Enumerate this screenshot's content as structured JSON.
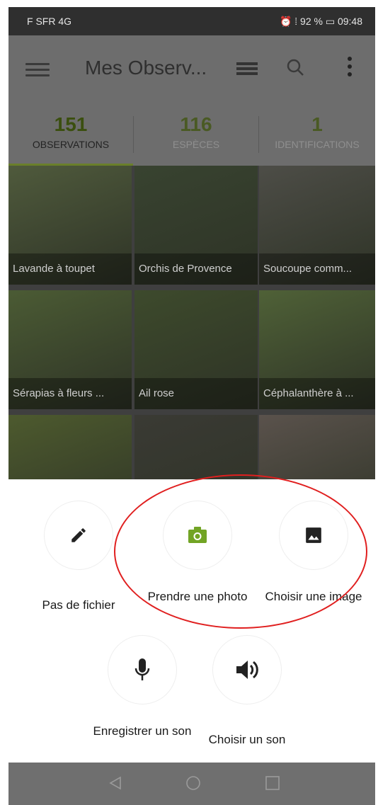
{
  "status": {
    "carrier": "F SFR 4G",
    "right": "⏰ ⁞ 92 % ▭ 09:48"
  },
  "appbar": {
    "title": "Mes Observ..."
  },
  "tabs": [
    {
      "count": "151",
      "label": "OBSERVATIONS"
    },
    {
      "count": "116",
      "label": "ESPÈCES"
    },
    {
      "count": "1",
      "label": "IDENTIFICATIONS"
    }
  ],
  "observations": [
    {
      "name": "Lavande à toupet",
      "color": "#4f5a3c"
    },
    {
      "name": "Orchis de Provence",
      "color": "#384330"
    },
    {
      "name": "Soucoupe comm...",
      "color": "#4d4d47"
    },
    {
      "name": "Sérapias à fleurs ...",
      "color": "#4b5b34"
    },
    {
      "name": "Ail rose",
      "color": "#3d4a2c"
    },
    {
      "name": "Céphalanthère à ...",
      "color": "#4f6137"
    },
    {
      "name": "",
      "color": "#4d5a2e"
    },
    {
      "name": "",
      "color": "#3a3a34"
    },
    {
      "name": "",
      "color": "#5a524c"
    }
  ],
  "options": {
    "no_file": "Pas de fichier",
    "take_photo": "Prendre une photo",
    "choose_image": "Choisir une image",
    "record_sound": "Enregistrer un son",
    "choose_sound": "Choisir un son"
  },
  "colors": {
    "accent": "#72a425",
    "highlight": "#e01f1f"
  },
  "icons": {
    "pencil": "pencil-icon",
    "camera": "camera-icon",
    "image": "image-icon",
    "mic": "microphone-icon",
    "speaker": "speaker-icon"
  }
}
